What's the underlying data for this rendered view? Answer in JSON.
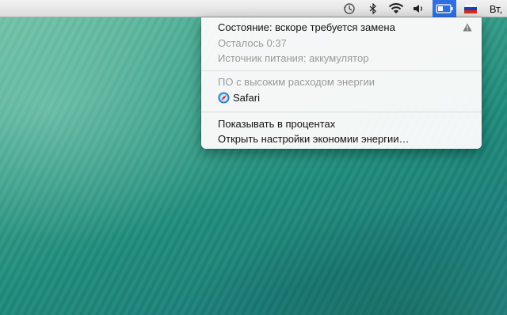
{
  "menubar": {
    "clock": "Вт,",
    "icons": [
      "time-machine-icon",
      "bluetooth-icon",
      "wifi-icon",
      "volume-icon",
      "battery-icon",
      "russian-flag-icon"
    ]
  },
  "battery_menu": {
    "status": "Состояние: вскоре требуется замена",
    "remaining": "Осталось 0:37",
    "power_source": "Источник питания: аккумулятор",
    "section_title": "ПО с высоким расходом энергии",
    "apps": [
      {
        "name": "Safari",
        "icon": "safari-icon"
      }
    ],
    "show_percent": "Показывать в процентах",
    "open_settings": "Открыть настройки экономии энергии…",
    "warning_icon": "warning-icon"
  },
  "colors": {
    "accent": "#2f6fdf",
    "menu_bg": "#fafafa",
    "dim_text": "#9a9a9a"
  }
}
